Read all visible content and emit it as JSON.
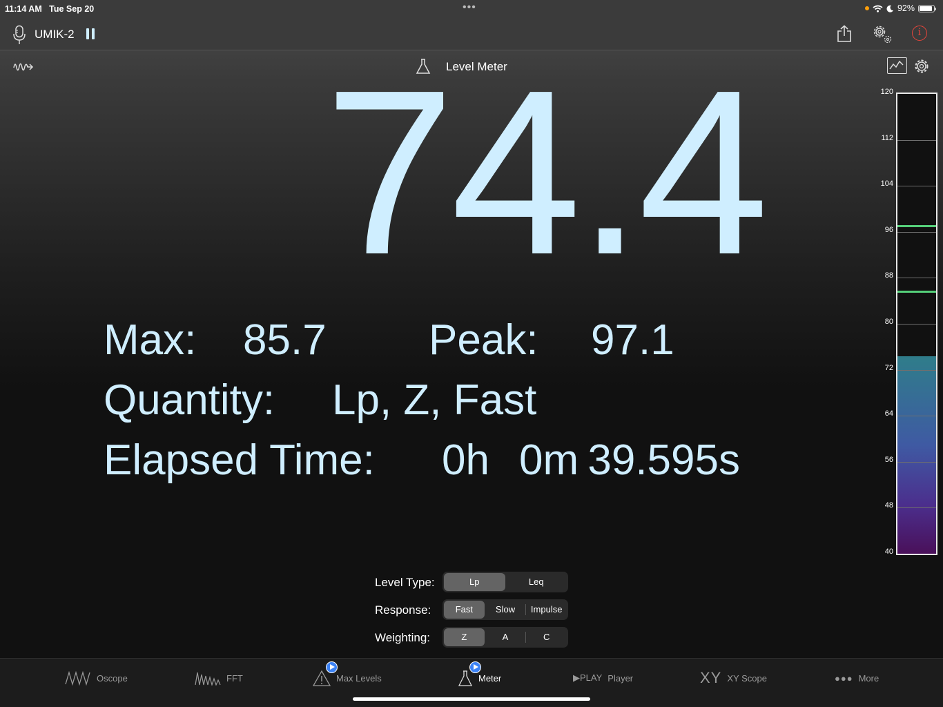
{
  "status_bar": {
    "time": "11:14 AM",
    "date": "Tue Sep 20",
    "battery": "92%",
    "battery_level": 0.92
  },
  "toolbar": {
    "device_name": "UMIK-2"
  },
  "subheader": {
    "title": "Level Meter"
  },
  "reading": {
    "value": "74.4",
    "max_label": "Max:",
    "max_value": "85.7",
    "peak_label": "Peak:",
    "peak_value": "97.1",
    "quantity_label": "Quantity:",
    "quantity_value": "Lp, Z, Fast",
    "elapsed_label": "Elapsed Time:",
    "elapsed_hours": "0h",
    "elapsed_rest": "0m 39.595s"
  },
  "meter": {
    "min": 40,
    "max": 120,
    "level": 74.4,
    "max_marker": 85.7,
    "peak_marker": 97.1,
    "ticks": [
      "120",
      "112",
      "104",
      "96",
      "88",
      "80",
      "72",
      "64",
      "56",
      "48",
      "40"
    ],
    "marker_color": "#55d07a"
  },
  "controls": {
    "level_type": {
      "label": "Level Type:",
      "options": [
        "Lp",
        "Leq"
      ],
      "selected": "Lp"
    },
    "response": {
      "label": "Response:",
      "options": [
        "Fast",
        "Slow",
        "Impulse"
      ],
      "selected": "Fast"
    },
    "weighting": {
      "label": "Weighting:",
      "options": [
        "Z",
        "A",
        "C"
      ],
      "selected": "Z"
    }
  },
  "tabs": [
    {
      "label": "Oscope",
      "icon": "oscope-wave-icon"
    },
    {
      "label": "FFT",
      "icon": "fft-spectrum-icon"
    },
    {
      "label": "Max Levels",
      "icon": "warning-triangle-icon"
    },
    {
      "label": "Meter",
      "icon": "flask-icon",
      "active": true
    },
    {
      "label": "Player",
      "icon_text": "▶PLAY"
    },
    {
      "label": "XY Scope",
      "icon_text": "XY"
    },
    {
      "label": "More",
      "icon": "ellipsis-icon"
    }
  ],
  "colors": {
    "text_accent": "#cfeeff",
    "info_red": "#e5453b",
    "badge_blue": "#3b82f6"
  }
}
